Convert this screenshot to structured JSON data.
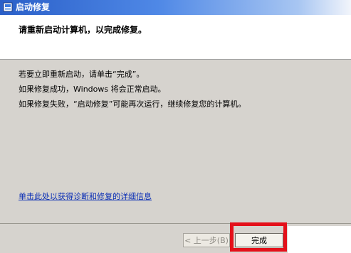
{
  "window": {
    "title": "启动修复"
  },
  "header": {
    "message": "请重新启动计算机，以完成修复。"
  },
  "body": {
    "lines": [
      "若要立即重新启动，请单击“完成”。",
      "如果修复成功，Windows 将会正常启动。",
      "如果修复失败，“启动修复”可能再次运行，继续修复您的计算机。"
    ],
    "detail_link": "单击此处以获得诊断和修复的详细信息"
  },
  "footer": {
    "back_label": "< 上一步(B)",
    "finish_label": "完成"
  },
  "colors": {
    "title_bar": "#2a5fc8",
    "link": "#0a2eb5",
    "highlight": "#e4101a"
  }
}
